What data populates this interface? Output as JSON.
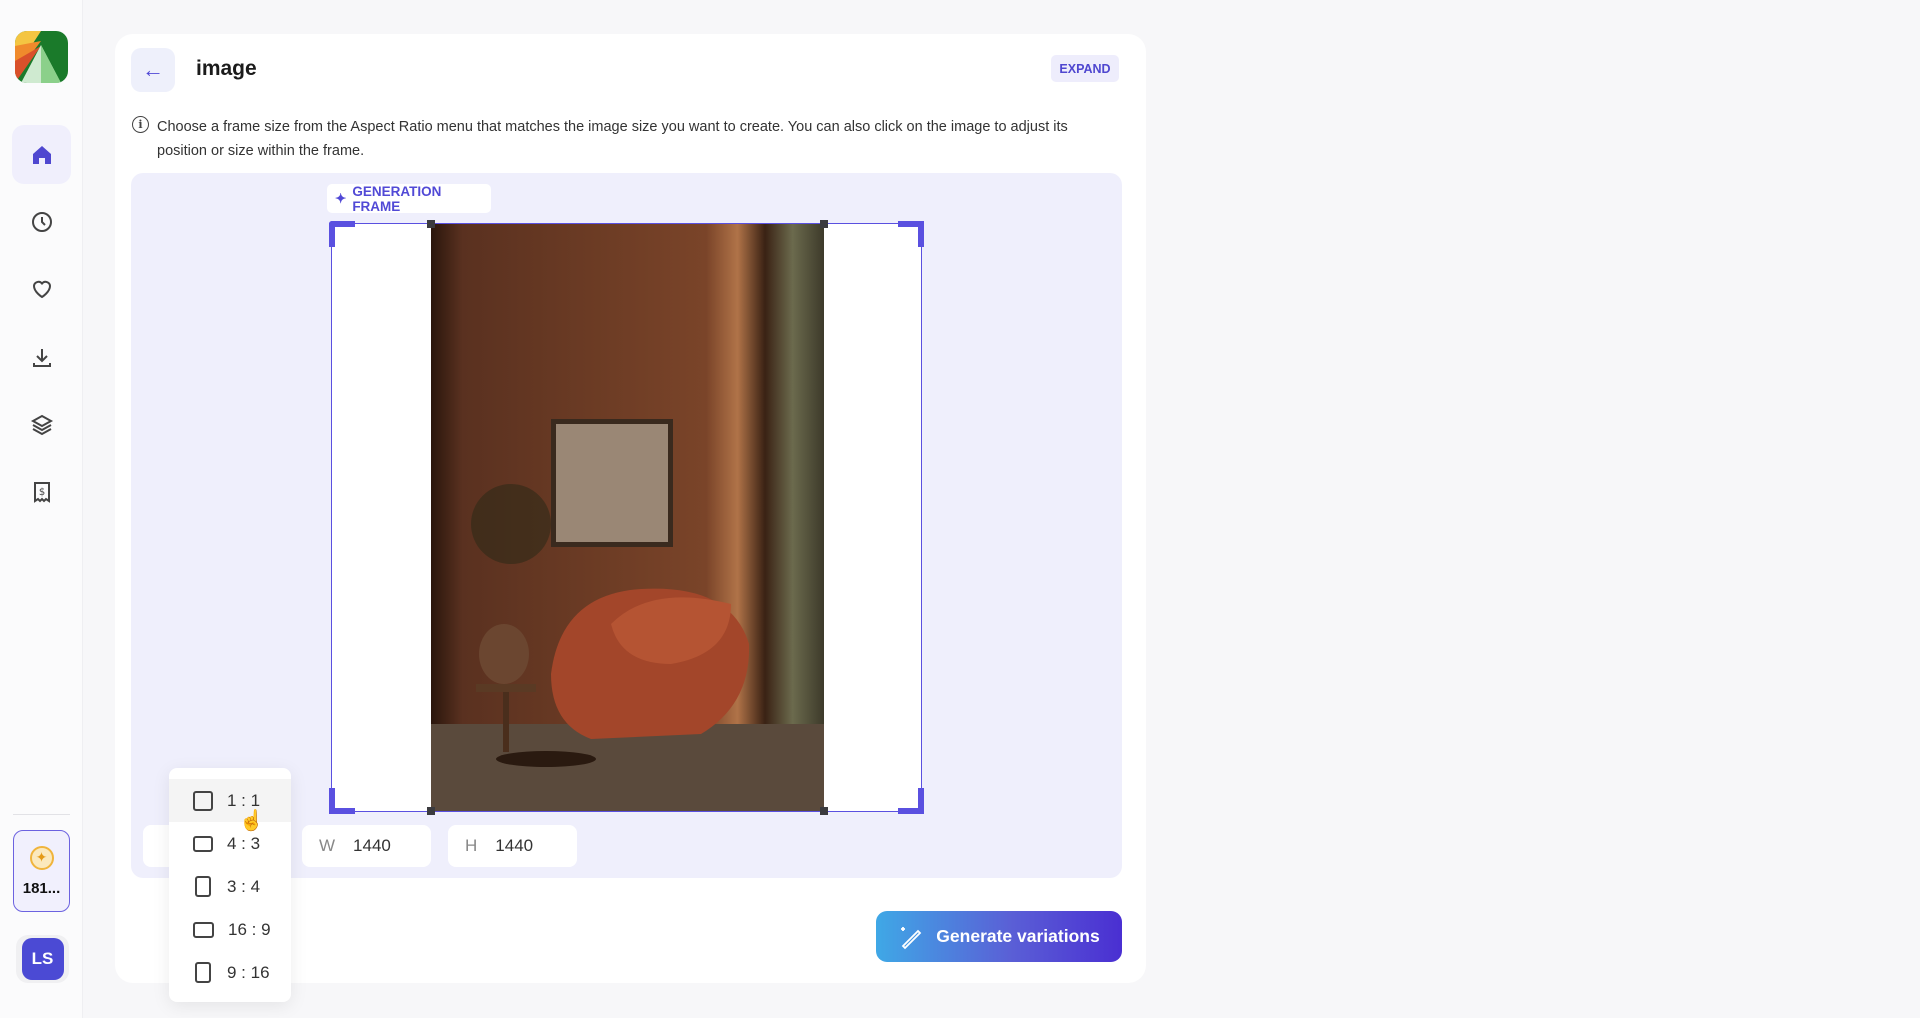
{
  "header": {
    "title": "image",
    "expand_label": "EXPAND",
    "back_icon": "arrow-left-icon"
  },
  "info_text": "Choose a frame size from the Aspect Ratio menu that matches the image size you want to create. You can also click on the image to adjust its position or size within the frame.",
  "canvas": {
    "frame_label": "GENERATION FRAME"
  },
  "size": {
    "width_label": "W",
    "width_value": "1440",
    "height_label": "H",
    "height_value": "1440"
  },
  "aspect_menu": {
    "options": [
      "1 : 1",
      "4 : 3",
      "3 : 4",
      "16 : 9",
      "9 : 16"
    ],
    "hovered": "1 : 1"
  },
  "generate_label": "Generate variations",
  "sidebar": {
    "items": [
      "home",
      "history",
      "favorites",
      "downloads",
      "layers",
      "billing"
    ],
    "credits": "181...",
    "avatar": "LS"
  },
  "colors": {
    "accent": "#5149d6",
    "canvas_bg": "#efeffc"
  }
}
